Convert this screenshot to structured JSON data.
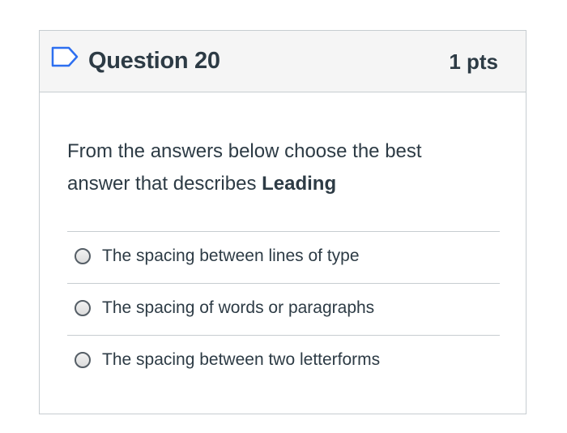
{
  "question": {
    "title": "Question 20",
    "points": "1 pts",
    "prompt_prefix": "From the answers below choose the best answer that describes ",
    "prompt_term": "Leading",
    "flag_icon": "flag-outline-icon"
  },
  "answers": [
    {
      "label": "The spacing between lines of type",
      "selected": false
    },
    {
      "label": "The spacing of words or paragraphs",
      "selected": false
    },
    {
      "label": "The spacing between two letterforms",
      "selected": false
    }
  ],
  "colors": {
    "text": "#2d3b45",
    "header_bg": "#f5f5f5",
    "border": "#c7cdd1",
    "flag": "#2d6ff0"
  }
}
